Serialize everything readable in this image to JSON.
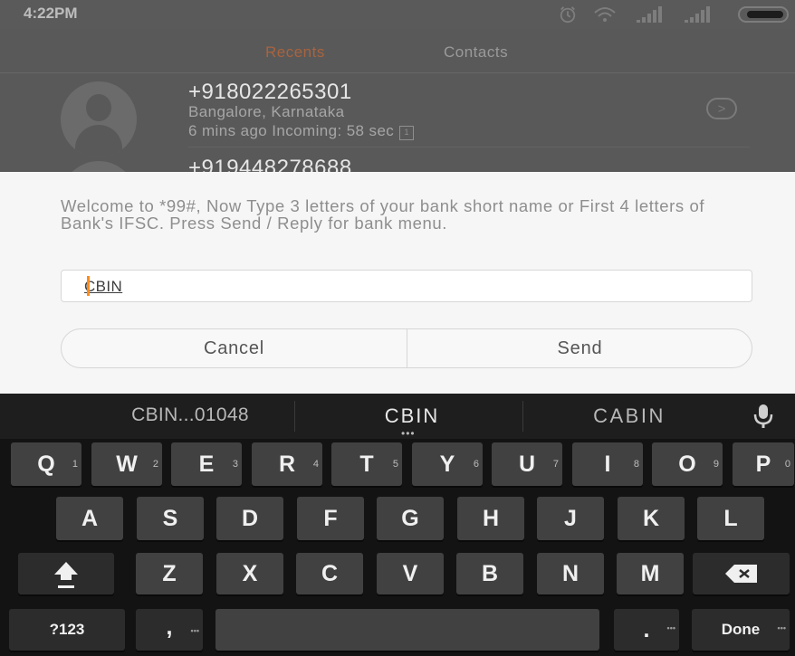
{
  "status_bar": {
    "time": "4:22PM",
    "icons": [
      "alarm-icon",
      "wifi-icon",
      "signal-icon",
      "signal-icon",
      "battery-icon"
    ]
  },
  "tabs": [
    {
      "label": "Recents",
      "active": true
    },
    {
      "label": "Contacts",
      "active": false
    }
  ],
  "calls": [
    {
      "number": "+918022265301",
      "location": "Bangalore, Karnataka",
      "detail": "6 mins ago Incoming: 58 sec"
    },
    {
      "number": "+919448278688"
    }
  ],
  "dialog": {
    "message": "Welcome to *99#, Now Type 3 letters of your bank short name or First 4 letters of Bank's IFSC. Press Send / Reply for bank menu.",
    "input_value": "CBIN",
    "cancel_label": "Cancel",
    "send_label": "Send"
  },
  "keyboard": {
    "suggestions": [
      "CBIN...01048",
      "CBIN",
      "CABIN"
    ],
    "row1": [
      {
        "key": "Q",
        "hint": "1"
      },
      {
        "key": "W",
        "hint": "2"
      },
      {
        "key": "E",
        "hint": "3"
      },
      {
        "key": "R",
        "hint": "4"
      },
      {
        "key": "T",
        "hint": "5"
      },
      {
        "key": "Y",
        "hint": "6"
      },
      {
        "key": "U",
        "hint": "7"
      },
      {
        "key": "I",
        "hint": "8"
      },
      {
        "key": "O",
        "hint": "9"
      },
      {
        "key": "P",
        "hint": "0"
      }
    ],
    "row2": [
      "A",
      "S",
      "D",
      "F",
      "G",
      "H",
      "J",
      "K",
      "L"
    ],
    "row3": [
      "Z",
      "X",
      "C",
      "V",
      "B",
      "N",
      "M"
    ],
    "symbols_label": "?123",
    "comma_label": ",",
    "period_label": ".",
    "done_label": "Done"
  },
  "colors": {
    "accent_tab": "#a9633e",
    "cursor": "#ff8c1a",
    "dialog_bg": "#f6f6f6",
    "keyboard_bg": "#131313",
    "key_bg": "#414141"
  }
}
